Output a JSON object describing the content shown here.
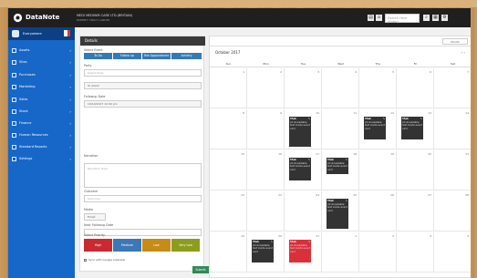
{
  "app": {
    "brand": "DataNote",
    "company": "MEDI MEDIWM CARE LTD.(BRITAIN)",
    "company_sub": "PATIENT: TRACY LANDRY",
    "search_placeholder": "Search Here (Enter)"
  },
  "sidebar": {
    "user": "Everywhere",
    "items": [
      {
        "label": "Assets",
        "icon": "assets-icon"
      },
      {
        "label": "Sites",
        "icon": "sites-icon"
      },
      {
        "label": "Purchases",
        "icon": "purchases-icon"
      },
      {
        "label": "Marketing",
        "icon": "marketing-icon"
      },
      {
        "label": "Sales",
        "icon": "sales-icon"
      },
      {
        "label": "Stock",
        "icon": "stock-icon"
      },
      {
        "label": "Finance",
        "icon": "finance-icon"
      },
      {
        "label": "Human Resources",
        "icon": "hr-icon"
      },
      {
        "label": "Standard Reports",
        "icon": "reports-icon"
      },
      {
        "label": "Settings",
        "icon": "settings-icon"
      }
    ]
  },
  "form": {
    "title": "Details",
    "select_event": "Select Event",
    "segments": [
      "To Do",
      "Follow up",
      "Tele Appointment",
      "Activity"
    ],
    "party_label": "Party",
    "party_placeholder": "Select Party",
    "to_whom": "To whom",
    "followup_date_label": "Followup Date",
    "followup_date": "10/10/2017 12:00 pm",
    "narration_label": "Narration",
    "narration_placeholder": "Narration Here",
    "outcome_label": "Outcome",
    "outcome_placeholder": "Outcome",
    "media_label": "Media",
    "media_value": "Email",
    "next_date_label": "Next Followup Date",
    "priority_label": "Select Priority",
    "priorities": [
      "High",
      "Medium",
      "Low",
      "Very Low"
    ],
    "sync_label": "Sync with Google Calendar",
    "submit": "Submit"
  },
  "calendar": {
    "month": "October 2017",
    "view": "Month",
    "weekdays": [
      "Sun",
      "Mon",
      "Tue",
      "Wed",
      "Thu",
      "Fri",
      "Sat"
    ],
    "dates": [
      "1",
      "2",
      "3",
      "4",
      "5",
      "6",
      "7",
      "8",
      "9",
      "10",
      "11",
      "12",
      "13",
      "14",
      "15",
      "16",
      "17",
      "18",
      "19",
      "20",
      "21",
      "22",
      "23",
      "24",
      "25",
      "26",
      "27",
      "28",
      "29",
      "30",
      "31",
      "1",
      "2",
      "3",
      "4"
    ],
    "event_title": "TAsk",
    "event_text": "At Unreadable text inside event card"
  },
  "colors": {
    "sidebar": "#1667c7",
    "topbar": "#1f1f1f",
    "event": "#333333",
    "event_urgent": "#d9303c",
    "priority_high": "#c9292f",
    "priority_medium": "#3c78b5",
    "priority_low": "#c78b18",
    "priority_very_low": "#8b9d1c"
  }
}
